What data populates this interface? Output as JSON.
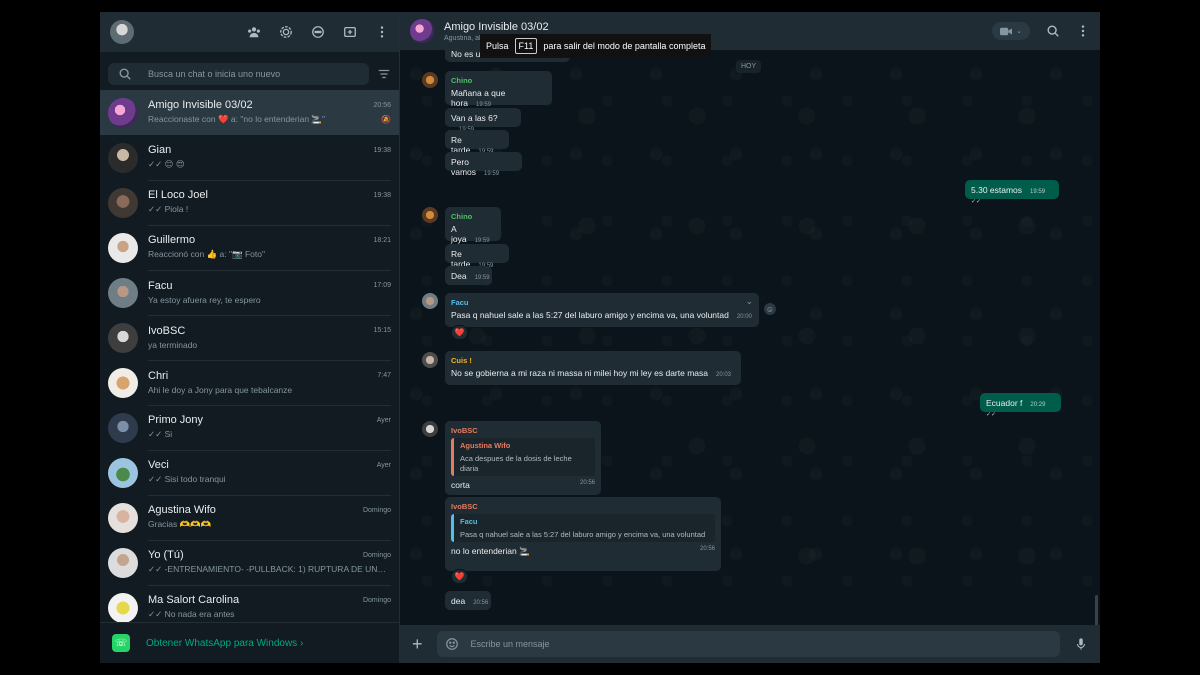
{
  "fullscreen_notice": {
    "before": "Pulsa",
    "key": "F11",
    "after": "para salir del modo de pantalla completa"
  },
  "search": {
    "placeholder": "Busca un chat o inicia uno nuevo"
  },
  "chats": [
    {
      "name": "Amigo Invisible 03/02",
      "time": "20:56",
      "preview_prefix": "Reaccionaste con",
      "preview_emoji": "❤️",
      "preview_rest": " a: \"no lo entenderian 🚬\"",
      "muted": true
    },
    {
      "name": "Gian",
      "time": "19:38",
      "preview": "✓✓ 😊 😍"
    },
    {
      "name": "El Loco Joel",
      "time": "19:38",
      "preview": "✓✓ Piola !"
    },
    {
      "name": "Guillermo",
      "time": "18:21",
      "preview": "Reaccionó con 👍 a: \"📷 Foto\""
    },
    {
      "name": "Facu",
      "time": "17:09",
      "preview": "Ya estoy afuera rey, te espero"
    },
    {
      "name": "IvoBSC",
      "time": "15:15",
      "preview": "ya terminado"
    },
    {
      "name": "Chri",
      "time": "7:47",
      "preview": "Ahi le doy a Jony para que tebalcanze"
    },
    {
      "name": "Primo Jony",
      "time": "Ayer",
      "preview": "✓✓ Si"
    },
    {
      "name": "Veci",
      "time": "Ayer",
      "preview": "✓✓ Sisi todo tranqui"
    },
    {
      "name": "Agustina Wifo",
      "time": "Domingo",
      "preview": "Gracias 🫶🫶🫶"
    },
    {
      "name": "Yo (Tú)",
      "time": "Domingo",
      "preview": "✓✓ -ENTRENAMIENTO- -PULLBACK: 1) RUPTURA DE UNA Z..."
    },
    {
      "name": "Ma Salort Carolina",
      "time": "Domingo",
      "preview": "✓✓ No nada era antes"
    }
  ],
  "footer": {
    "link": "Obtener WhatsApp para Windows ›"
  },
  "conversation": {
    "title": "Amigo Invisible 03/02",
    "members": "Agustina, ali... +54 9 11 6651-3432, +54 9 2954 66-2145, Tú",
    "date_chip": "HOY",
    "messages": [
      {
        "text": "No es una vida",
        "time": "19:59"
      },
      {
        "sender": "Chino",
        "text": "Mañana a que hora",
        "time": "19:59"
      },
      {
        "text": "Van a las 6?",
        "time": "19:59"
      },
      {
        "text": "Re tarde",
        "time": "19:59"
      },
      {
        "text": "Pero vamos",
        "time": "19:59"
      },
      {
        "text": "5.30 estamos",
        "time": "19:59 ✓✓"
      },
      {
        "sender": "Chino",
        "text": "A joya",
        "time": "19:59"
      },
      {
        "text": "Re tarde",
        "time": "19:59"
      },
      {
        "text": "Dea",
        "time": "19:59"
      },
      {
        "sender": "Facu",
        "text": "Pasa q nahuel sale a las 5:27 del laburo amigo y encima va, una voluntad",
        "time": "20:00",
        "reaction": "❤️"
      },
      {
        "sender": "Cuis !",
        "text": "No se gobierna a mi raza ni massa ni milei hoy mi ley es darte masa",
        "time": "20:03"
      },
      {
        "text": "Ecuador f",
        "time": "20:29 ✓✓"
      },
      {
        "sender": "IvoBSC",
        "quote_name": "Agustina Wifo",
        "quote_text": "Aca despues de la dosis de leche diaria",
        "text": "corta",
        "time": "20:56"
      },
      {
        "sender": "IvoBSC",
        "quote_name": "Facu",
        "quote_text": "Pasa q nahuel sale a las 5:27 del laburo amigo y encima va, una voluntad",
        "text": "no lo entenderian 🚬",
        "time": "20:56",
        "reaction": "❤️"
      },
      {
        "text": "dea",
        "time": "20:56"
      }
    ]
  },
  "composer": {
    "placeholder": "Escribe un mensaje"
  },
  "colors": {
    "accent": "#00a884",
    "outgoing": "#005c4b",
    "incoming": "#202c33",
    "chino": "#4fbf6b",
    "facu": "#53bdeb",
    "cuis": "#f0b330",
    "ivo": "#e47b60"
  }
}
